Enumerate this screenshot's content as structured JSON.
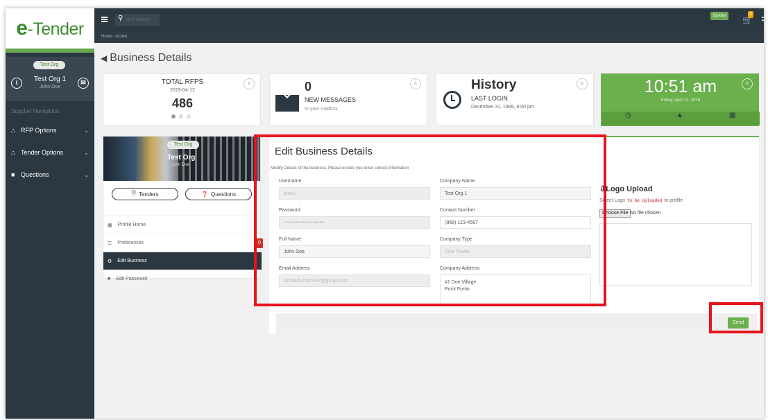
{
  "app": {
    "logo_text": "Tender",
    "logo_prefix": "e"
  },
  "topbar": {
    "search_placeholder": "RFP Search",
    "guides_label": "Guides",
    "cart_count": "0"
  },
  "breadcrumb": {
    "path": "Home  ›  Active"
  },
  "sidebar": {
    "org_logo_alt": "Test Org",
    "org_name": "Test Org 1",
    "org_user": "John Doe",
    "nav_title": "Supplier Navigation",
    "items": [
      {
        "label": "RFP Options",
        "icon": "rfp-icon"
      },
      {
        "label": "Tender Options",
        "icon": "tender-icon"
      },
      {
        "label": "Questions",
        "icon": "questions-icon"
      }
    ]
  },
  "page": {
    "title": "Business Details"
  },
  "stats": {
    "rfps": {
      "title": "TOTAL RFPS",
      "date": "2019-04-12",
      "count": "486"
    },
    "messages": {
      "count": "0",
      "label": "NEW MESSAGES",
      "sub": "In your mailbox"
    },
    "history": {
      "title": "History",
      "label": "LAST LOGIN",
      "sub": "December 31, 1969, 8:00 pm"
    },
    "clock": {
      "time": "10:51 am",
      "date": "Friday, April 12, 2019"
    }
  },
  "profile": {
    "logo_alt": "Test Org",
    "name": "Test Org",
    "user": "John Doe",
    "tenders_btn": "Tenders",
    "questions_btn": "Questions",
    "menu": [
      {
        "label": "Profile Home"
      },
      {
        "label": "Preferences",
        "badge": "0"
      },
      {
        "label": "Edit Business"
      },
      {
        "label": "Edit Password"
      }
    ]
  },
  "edit_form": {
    "title": "Edit Business Details",
    "description": "Modify Details of the business. Please ensure you enter correct information",
    "username_label": "Username",
    "username_value": "jdoe1",
    "password_label": "Password",
    "password_value": "••••••••••••••••••••••••",
    "fullname_label": "Full Name",
    "fullname_value": "John Doe",
    "email_label": "Email Address",
    "email_value": "kimberly.mcmiller@gmail.com",
    "company_name_label": "Company Name",
    "company_name_value": "Test Org 1",
    "contact_label": "Contact Number",
    "contact_value": "(868) 123-4567",
    "company_type_label": "Company Type",
    "company_type_value": "Sole Trader",
    "address_label": "Company Address",
    "address_line1": "#1 Doe Village",
    "address_line2": "Point Fortin"
  },
  "logo_upload": {
    "title": "Logo Upload",
    "desc_prefix": "Select Logo",
    "desc_code": "to be uploaded",
    "desc_suffix": "to profile",
    "choose_label": "Choose File",
    "no_file": "No file chosen"
  },
  "send_label": "Send",
  "colors": {
    "green": "#6ab04c",
    "dark": "#2c3841",
    "highlight_red": "#e8131b"
  }
}
